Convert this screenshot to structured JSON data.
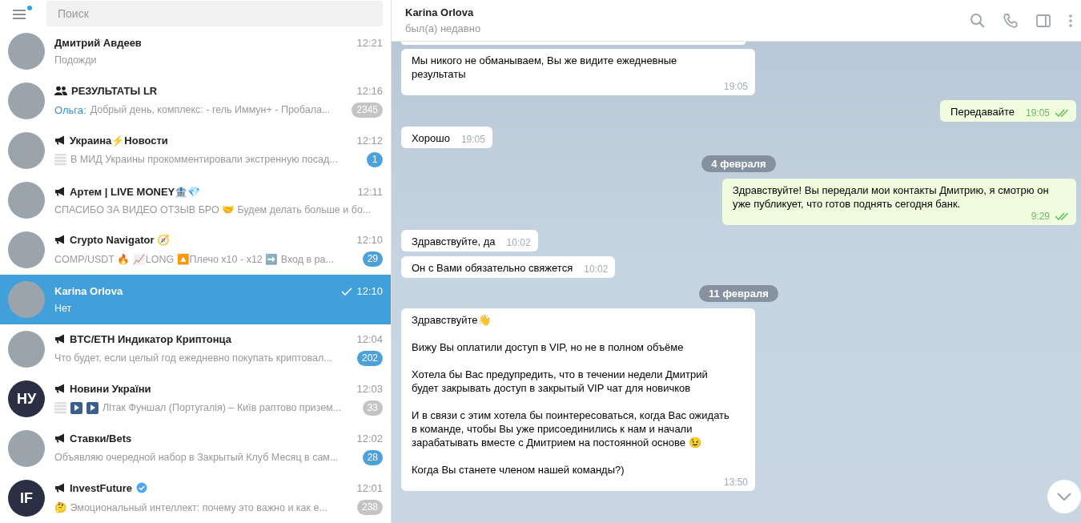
{
  "sidebar": {
    "menu_unread": true,
    "search": {
      "placeholder": "Поиск"
    },
    "chats": [
      {
        "name": "Дмитрий Авдеев",
        "kind": "user",
        "verified": false,
        "time": "12:21",
        "preview": "Подожди",
        "selected": false,
        "read": false
      },
      {
        "name": "РЕЗУЛЬТАТЫ LR",
        "kind": "group",
        "verified": false,
        "time": "12:16",
        "sender": "Ольга:",
        "preview": "Добрый день, комплекс:  - гель Иммун+ - Пробала...",
        "badge": "2345",
        "muted": true,
        "selected": false,
        "read": false
      },
      {
        "name": "Украина⚡Новости",
        "kind": "channel",
        "verified": false,
        "time": "12:12",
        "thumbnails": [
          {
            "kind": "image"
          }
        ],
        "preview": "В МИД Украины прокомментировали экстренную посад...",
        "badge": "1",
        "muted": false,
        "selected": false,
        "read": false
      },
      {
        "name": "Артем | LIVE MONEY🏦💎",
        "kind": "channel",
        "verified": false,
        "time": "12:11",
        "preview": "СПАСИБО ЗА ВИДЕО ОТЗЫВ БРО 🤝  Будем делать больше и бо...",
        "selected": false,
        "read": false
      },
      {
        "name": "Crypto Navigator 🧭",
        "kind": "channel",
        "verified": false,
        "time": "12:10",
        "preview": "COMP/USDT 🔥  📈LONG 🔼Плечо x10 - x12  ➡️ Вход в ра...",
        "badge": "29",
        "muted": false,
        "selected": false,
        "read": false
      },
      {
        "name": "Karina Orlova",
        "kind": "user",
        "verified": false,
        "time": "12:10",
        "preview": "Нет",
        "selected": true,
        "read": true
      },
      {
        "name": "BTC/ETH Индикатор Криптонца",
        "kind": "channel",
        "verified": false,
        "time": "12:04",
        "preview": "Что будет, если целый год ежедневно покупать криптовал...",
        "badge": "202",
        "muted": false,
        "selected": false,
        "read": false
      },
      {
        "name": "Новини України",
        "kind": "channel",
        "verified": false,
        "time": "12:03",
        "thumbnails": [
          {
            "kind": "image"
          },
          {
            "kind": "video"
          },
          {
            "kind": "video"
          }
        ],
        "preview": "Літак Фуншал (Португалія) – Київ раптово призем...",
        "badge": "33",
        "muted": true,
        "avatar_text": "НУ",
        "selected": false,
        "read": false
      },
      {
        "name": "Ставки/Bets",
        "kind": "channel",
        "verified": false,
        "time": "12:02",
        "preview": "Объявляю очередной набор в Закрытый Клуб  Месяц в сам...",
        "badge": "28",
        "muted": false,
        "selected": false,
        "read": false
      },
      {
        "name": "InvestFuture",
        "kind": "channel",
        "verified": true,
        "time": "12:01",
        "preview": "🤔 Эмоциональный интеллект: почему это важно и как е...",
        "badge": "238",
        "muted": true,
        "avatar_text": "IF",
        "selected": false,
        "read": false
      }
    ]
  },
  "chat": {
    "title": "Karina Orlova",
    "status": "был(а) недавно",
    "items": [
      {
        "kind": "message",
        "outgoing": false,
        "text": "Мы никого не обманываем, Вы же видите ежедневные результаты",
        "time": "19:05"
      },
      {
        "kind": "message",
        "outgoing": true,
        "text": "Передавайте",
        "time": "19:05",
        "read": true
      },
      {
        "kind": "message",
        "outgoing": false,
        "text": "Хорошо",
        "time": "19:05"
      },
      {
        "kind": "date",
        "text": "4 февраля"
      },
      {
        "kind": "message",
        "outgoing": true,
        "text": "Здравствуйте! Вы передали мои контакты Дмитрию, я смотрю он уже публикует, что готов поднять сегодня банк.",
        "time": "9:29",
        "read": true
      },
      {
        "kind": "message",
        "outgoing": false,
        "text": "Здравствуйте, да",
        "time": "10:02"
      },
      {
        "kind": "message",
        "outgoing": false,
        "text": "Он с Вами обязательно свяжется",
        "time": "10:02"
      },
      {
        "kind": "date",
        "text": "11 февраля"
      },
      {
        "kind": "message",
        "outgoing": false,
        "text": "Здравствуйте👋\n\nВижу Вы оплатили доступ в VIP, но не в полном объёме\n\nХотела бы Вас предупредить, что в течении недели Дмитрий будет закрывать доступ в закрытый VIP чат для новичков\n\nИ в связи с этим хотела бы поинтересоваться, когда Вас ожидать в команде, чтобы Вы уже присоединились к нам и начали зарабатывать вместе с Дмитрием на постоянной основе 😉\n\nКогда Вы станете членом нашей команды?)",
        "time": "13:50"
      }
    ]
  }
}
